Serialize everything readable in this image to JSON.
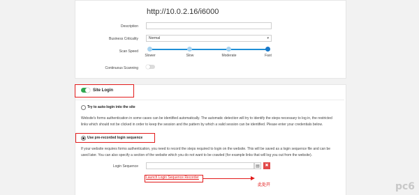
{
  "target_url": "http://10.0.2.16/i6000",
  "form": {
    "description_label": "Description",
    "business_criticality_label": "Business Criticality",
    "business_criticality_value": "Normal",
    "scan_speed_label": "Scan Speed",
    "scan_speed_options": [
      "Slower",
      "Slow",
      "Moderate",
      "Fast"
    ],
    "scan_speed_selected": "Fast",
    "continuous_scanning_label": "Continuous Scanning",
    "continuous_scanning_enabled": false
  },
  "site_login": {
    "title": "Site Login",
    "enabled": true,
    "option_auto": "Try to auto-login into the site",
    "auto_desc_1": "Website's forms authentication in some cases can be identified automatically. The automatic detection will try to identify the steps necessary to log in, the restricted",
    "auto_desc_2": "links which should not be clicked in order to keep the session and the pattern by which a valid session can be identified. Please enter your credentials below.",
    "option_recorded": "Use pre-recorded login sequence",
    "recorded_desc_1": "If your website requires forms authentication, you need to record the steps required to login on the website. This will be saved as a login sequence file and can be",
    "recorded_desc_2": "used later. You can also specify a section of the website which you do not want to be crawled (for example links that will log you out from the website).",
    "login_sequence_label": "Login Sequence",
    "launch_link": "Launch Login Sequence Recorder",
    "folder_icon": "folder-icon",
    "delete_icon": "close-icon"
  },
  "annotation": "此处开",
  "watermark": "pc6",
  "colors": {
    "accent": "#1979c9",
    "toggle_on": "#2fa84f",
    "highlight": "#e21b1b"
  }
}
